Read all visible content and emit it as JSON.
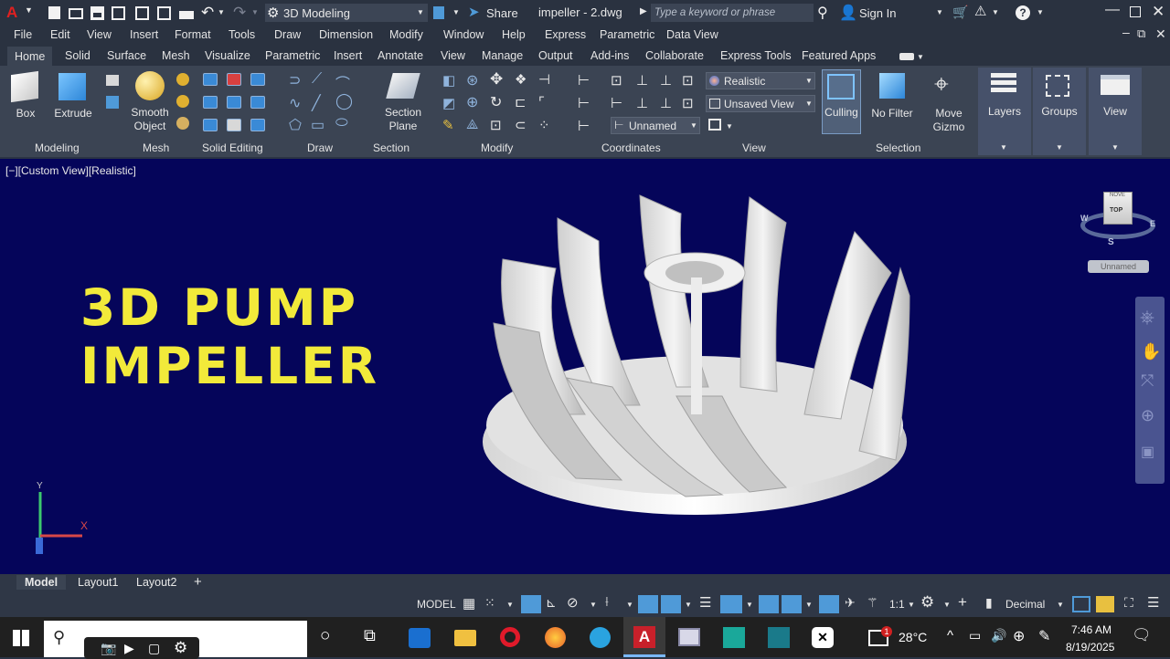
{
  "title_bar": {
    "workspace": "3D Modeling",
    "share": "Share",
    "filename": "impeller - 2.dwg",
    "search_placeholder": "Type a keyword or phrase",
    "sign_in": "Sign In"
  },
  "menu": [
    "File",
    "Edit",
    "View",
    "Insert",
    "Format",
    "Tools",
    "Draw",
    "Dimension",
    "Modify",
    "Window",
    "Help",
    "Express",
    "Parametric",
    "Data View"
  ],
  "ribbon_tabs": [
    "Home",
    "Solid",
    "Surface",
    "Mesh",
    "Visualize",
    "Parametric",
    "Insert",
    "Annotate",
    "View",
    "Manage",
    "Output",
    "Add-ins",
    "Collaborate",
    "Express Tools",
    "Featured Apps"
  ],
  "ribbon": {
    "box": "Box",
    "extrude": "Extrude",
    "smooth_object": [
      "Smooth",
      "Object"
    ],
    "section_plane": [
      "Section",
      "Plane"
    ],
    "visual_style": "Realistic",
    "saved_view": "Unsaved View",
    "ucs_named": "Unnamed",
    "culling": "Culling",
    "no_filter": "No Filter",
    "move_gizmo": [
      "Move",
      "Gizmo"
    ],
    "layers": "Layers",
    "groups": "Groups",
    "view": "View",
    "panels": [
      "Modeling",
      "Mesh",
      "Solid Editing",
      "Draw",
      "Section",
      "Modify",
      "Coordinates",
      "View",
      "Selection"
    ]
  },
  "viewport": {
    "label": "[−][Custom View][Realistic]",
    "overlay_line1": "3D PUMP",
    "overlay_line2": "IMPELLER",
    "viewcube_face": "TOP",
    "viewcube_back": "NOVE",
    "compass": {
      "w": "W",
      "e": "E",
      "s": "S"
    },
    "ucs_name": "Unnamed",
    "ucs_y": "Y",
    "ucs_x": "X"
  },
  "layout_tabs": [
    "Model",
    "Layout1",
    "Layout2"
  ],
  "status": {
    "model": "MODEL",
    "scale": "1:1",
    "units": "Decimal"
  },
  "taskbar": {
    "temperature": "28°C",
    "time": "7:46 AM",
    "date": "8/19/2025",
    "weather_badge": "1"
  },
  "colors": {
    "viewport_bg": "#05055a",
    "overlay_text": "#f2ea3a",
    "accent": "#4f9ad8"
  }
}
